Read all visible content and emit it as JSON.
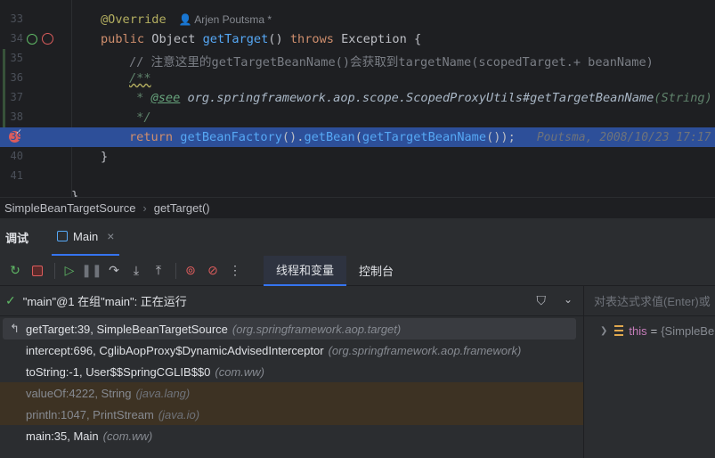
{
  "editor": {
    "author_inlay": "Arjen Poutsma *",
    "lines": [
      {
        "num": "33"
      },
      {
        "num": "34"
      },
      {
        "num": "35",
        "comment": "// 注意这里的getTargetBeanName()会获取到targetName(scopedTarget.+ beanName)"
      },
      {
        "num": "36",
        "doc_open": "/**"
      },
      {
        "num": "37",
        "doc_star": " * ",
        "doc_tag": "@see",
        "doc_ref": " org.springframework.aop.scope.ScopedProxyUtils#getTargetBeanName",
        "doc_args": "(String)"
      },
      {
        "num": "38",
        "doc_close": " */"
      },
      {
        "num": "39",
        "blame": "Poutsma, 2008/10/23 17:17"
      },
      {
        "num": "40"
      },
      {
        "num": "41"
      }
    ],
    "tokens": {
      "override": "@Override",
      "public": "public",
      "object": " Object ",
      "getTarget": "getTarget",
      "parens": "() ",
      "throws": "throws",
      "exception": " Exception {",
      "return": "return ",
      "getBeanFactory": "getBeanFactory",
      "dot1": "().",
      "getBean": "getBean",
      "paren_open": "(",
      "getTargetBeanName": "getTargetBeanName",
      "tail": "());",
      "close_brace": "}",
      "class_brace": "}"
    }
  },
  "breadcrumb": {
    "class_name": "SimpleBeanTargetSource",
    "method_name": "getTarget()"
  },
  "debug": {
    "title": "调试",
    "run_tab": "Main",
    "close_glyph": "×",
    "tabs": [
      "线程和变量",
      "控制台"
    ],
    "thread_status": "\"main\"@1 在组\"main\": 正在运行",
    "frames": [
      {
        "method": "getTarget:39, SimpleBeanTargetSource",
        "pkg": "(org.springframework.aop.target)",
        "kind": "selected"
      },
      {
        "method": "intercept:696, CglibAopProxy$DynamicAdvisedInterceptor",
        "pkg": "(org.springframework.aop.framework)",
        "kind": "normal"
      },
      {
        "method": "toString:-1, User$$SpringCGLIB$$0",
        "pkg": "(com.ww)",
        "kind": "normal"
      },
      {
        "method": "valueOf:4222, String",
        "pkg": "(java.lang)",
        "kind": "lib"
      },
      {
        "method": "println:1047, PrintStream",
        "pkg": "(java.io)",
        "kind": "lib"
      },
      {
        "method": "main:35, Main",
        "pkg": "(com.ww)",
        "kind": "normal"
      }
    ],
    "eval_placeholder": "对表达式求值(Enter)或",
    "variables": [
      {
        "name": "this",
        "eq": "=",
        "value": "{SimpleBe"
      }
    ]
  },
  "colors": {
    "exec_line": "#2d4f99",
    "breakpoint": "#db5c5c",
    "accent": "#3574f0",
    "library_frame": "#3d3223"
  }
}
